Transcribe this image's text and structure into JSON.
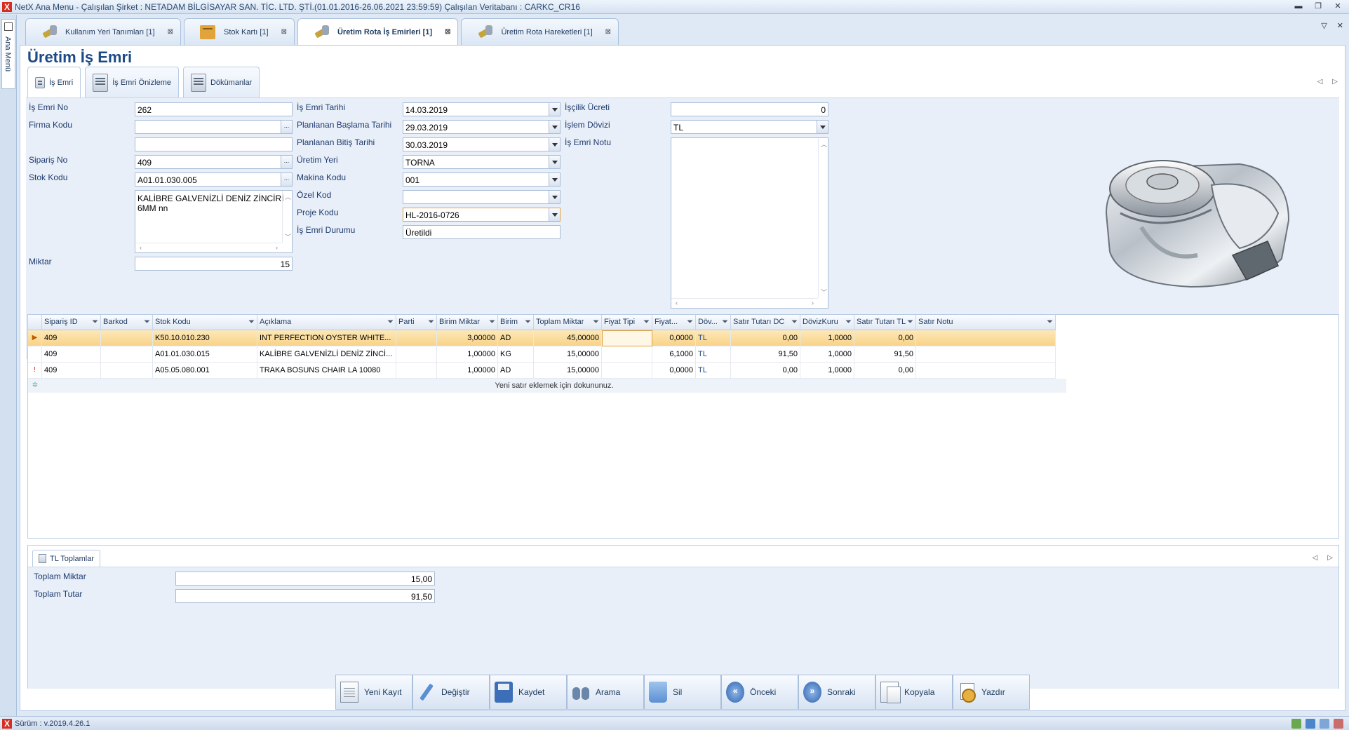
{
  "window": {
    "title": "NetX Ana Menu - Çalışılan Şirket : NETADAM BİLGİSAYAR SAN. TİC. LTD. ŞTİ.(01.01.2016-26.06.2021 23:59:59) Çalışılan Veritabanı : CARKC_CR16",
    "app_icon": "X"
  },
  "left_strip": {
    "label": "Ana Menü"
  },
  "doc_tabs": [
    {
      "label": "Kullanım Yeri Tanımları [1]",
      "icon": "tools-icon"
    },
    {
      "label": "Stok Kartı [1]",
      "icon": "box-icon"
    },
    {
      "label": "Üretim Rota İş Emirleri [1]",
      "icon": "tools-icon",
      "active": true
    },
    {
      "label": "Üretim Rota Hareketleri [1]",
      "icon": "tools-icon"
    }
  ],
  "page": {
    "title": "Üretim İş Emri"
  },
  "sub_tabs": [
    {
      "label": "İş Emri",
      "active": true
    },
    {
      "label": "İş Emri Önizleme"
    },
    {
      "label": "Dökümanlar"
    }
  ],
  "form": {
    "labels": {
      "is_emri_no": "İş Emri No",
      "firma_kodu": "Firma Kodu",
      "siparis_no": "Sipariş No",
      "stok_kodu": "Stok Kodu",
      "miktar": "Miktar",
      "is_emri_tarihi": "İş Emri Tarihi",
      "planlanan_baslama": "Planlanan Başlama Tarihi",
      "planlanan_bitis": "Planlanan Bitiş Tarihi",
      "uretim_yeri": "Üretim Yeri",
      "makina_kodu": "Makina Kodu",
      "ozel_kod": "Özel Kod",
      "proje_kodu": "Proje Kodu",
      "is_emri_durumu": "İş Emri Durumu",
      "iscilik_ucreti": "İşçilik Ücreti",
      "islem_dovizi": "İşlem Dövizi",
      "is_emri_notu": "İş Emri Notu"
    },
    "values": {
      "is_emri_no": "262",
      "firma_kodu": "",
      "firma_adi": "",
      "siparis_no": "409",
      "stok_kodu": "A01.01.030.005",
      "stok_aciklama": "KALİBRE GALVENİZLİ DENİZ ZİNCİRİ  6MM nn",
      "miktar": "15",
      "is_emri_tarihi": "14.03.2019",
      "planlanan_baslama": "29.03.2019",
      "planlanan_bitis": "30.03.2019",
      "uretim_yeri": "TORNA",
      "makina_kodu": "001",
      "ozel_kod": "",
      "proje_kodu": "HL-2016-0726",
      "is_emri_durumu": "Üretildi",
      "iscilik_ucreti": "0",
      "islem_dovizi": "TL",
      "is_emri_notu": ""
    },
    "lookup_button": "..."
  },
  "grid": {
    "columns": [
      "Sipariş ID",
      "Barkod",
      "Stok Kodu",
      "Açıklama",
      "Parti",
      "Birim Miktar",
      "Birim",
      "Toplam Miktar",
      "Fiyat Tipi",
      "Fiyat...",
      "Döv...",
      "Satır Tutarı DC",
      "DövizKuru",
      "Satır Tutarı TL",
      "Satır Notu"
    ],
    "rows": [
      {
        "siparis_id": "409",
        "barkod": "",
        "stok_kodu": "K50.10.010.230",
        "aciklama": "INT  PERFECTION  OYSTER  WHITE...",
        "parti": "",
        "birim_miktar": "3,00000",
        "birim": "AD",
        "toplam_miktar": "45,00000",
        "fiyat_tipi": "",
        "fiyat": "0,0000",
        "doviz": "TL",
        "satir_tutari_dc": "0,00",
        "doviz_kuru": "1,0000",
        "satir_tutari_tl": "0,00",
        "satir_notu": "",
        "indicator": "▶"
      },
      {
        "siparis_id": "409",
        "barkod": "",
        "stok_kodu": "A01.01.030.015",
        "aciklama": "KALİBRE  GALVENİZLİ  DENİZ  ZİNCİ...",
        "parti": "",
        "birim_miktar": "1,00000",
        "birim": "KG",
        "toplam_miktar": "15,00000",
        "fiyat_tipi": "",
        "fiyat": "6,1000",
        "doviz": "TL",
        "satir_tutari_dc": "91,50",
        "doviz_kuru": "1,0000",
        "satir_tutari_tl": "91,50",
        "satir_notu": "",
        "indicator": ""
      },
      {
        "siparis_id": "409",
        "barkod": "",
        "stok_kodu": "A05.05.080.001",
        "aciklama": "TRAKA  BOSUNS  CHAIR  LA  10080",
        "parti": "",
        "birim_miktar": "1,00000",
        "birim": "AD",
        "toplam_miktar": "15,00000",
        "fiyat_tipi": "",
        "fiyat": "0,0000",
        "doviz": "TL",
        "satir_tutari_dc": "0,00",
        "doviz_kuru": "1,0000",
        "satir_tutari_tl": "0,00",
        "satir_notu": "",
        "indicator": "!"
      }
    ],
    "new_row_text": "Yeni satır eklemek için dokununuz."
  },
  "totals": {
    "tab_label": "TL Toplamlar",
    "toplam_miktar_label": "Toplam Miktar",
    "toplam_miktar": "15,00",
    "toplam_tutar_label": "Toplam Tutar",
    "toplam_tutar": "91,50"
  },
  "toolbar": [
    {
      "label": "Yeni Kayıt",
      "icon": "new-doc-icon"
    },
    {
      "label": "Değiştir",
      "icon": "pencil-icon"
    },
    {
      "label": "Kaydet",
      "icon": "floppy-disk-icon"
    },
    {
      "label": "Arama",
      "icon": "binoculars-icon"
    },
    {
      "label": "Sil",
      "icon": "trash-icon"
    },
    {
      "label": "Önceki",
      "icon": "previous-icon"
    },
    {
      "label": "Sonraki",
      "icon": "next-icon"
    },
    {
      "label": "Kopyala",
      "icon": "copy-icon"
    },
    {
      "label": "Yazdır",
      "icon": "print-icon"
    }
  ],
  "status": {
    "version": "Sürüm : v.2019.4.26.1"
  }
}
